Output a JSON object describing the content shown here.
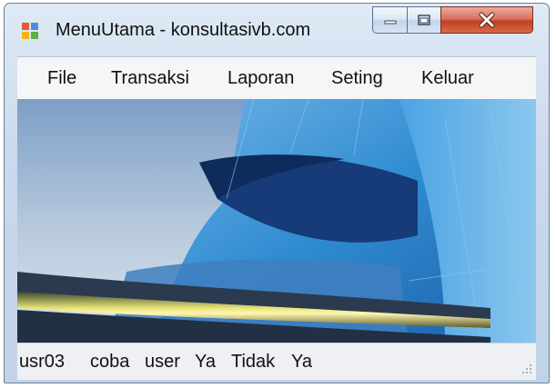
{
  "window": {
    "title": "MenuUtama - konsultasivb.com"
  },
  "titlebar": {
    "app_icon": "forms-app-icon",
    "minimize_icon": "minimize-icon",
    "maximize_icon": "maximize-icon",
    "close_icon": "close-icon"
  },
  "menu": {
    "items": [
      {
        "label": "File"
      },
      {
        "label": "Transaksi"
      },
      {
        "label": "Laporan"
      },
      {
        "label": "Seting"
      },
      {
        "label": "Keluar"
      }
    ]
  },
  "content": {
    "image": "background-image"
  },
  "status": {
    "panels": [
      {
        "text": "usr03"
      },
      {
        "text": "coba"
      },
      {
        "text": "user"
      },
      {
        "text": "Ya"
      },
      {
        "text": "Tidak"
      },
      {
        "text": "Ya"
      }
    ],
    "grip_icon": "resize-grip-icon"
  },
  "colors": {
    "close_button": "#c8462c",
    "menubar": "#f5f6f8",
    "statusbar": "#eef0f3"
  }
}
